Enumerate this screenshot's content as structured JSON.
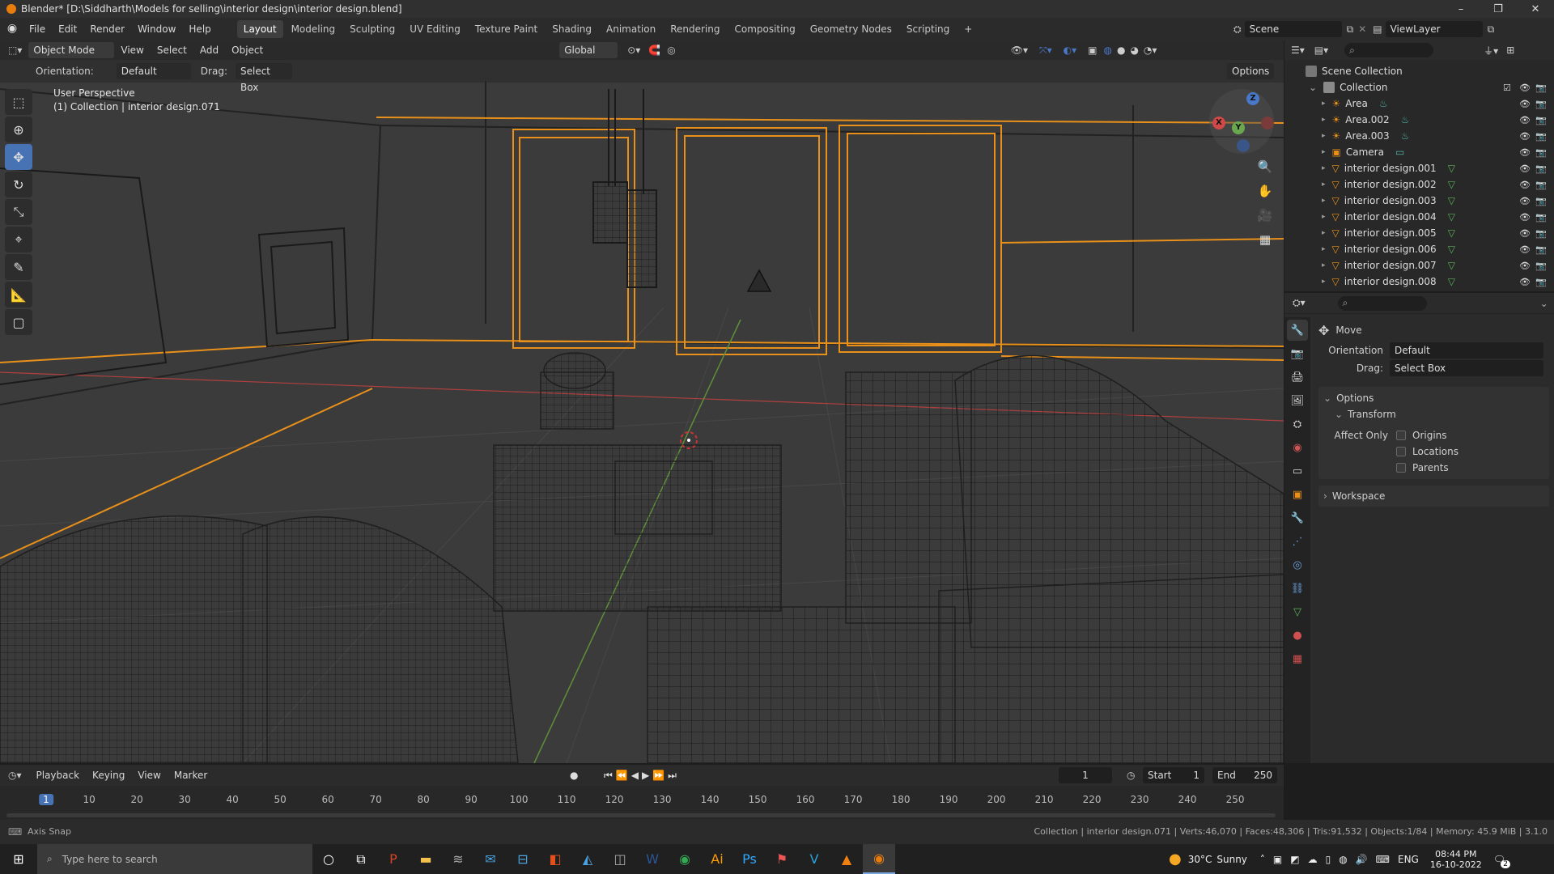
{
  "window": {
    "title": "Blender* [D:\\Siddharth\\Models for selling\\interior design\\interior design.blend]",
    "controls": [
      "–",
      "❐",
      "✕"
    ]
  },
  "menubar": {
    "menus": [
      "File",
      "Edit",
      "Render",
      "Window",
      "Help"
    ],
    "workspaces": [
      "Layout",
      "Modeling",
      "Sculpting",
      "UV Editing",
      "Texture Paint",
      "Shading",
      "Animation",
      "Rendering",
      "Compositing",
      "Geometry Nodes",
      "Scripting",
      "+"
    ],
    "active_workspace": "Layout",
    "scene": "Scene",
    "view_layer": "ViewLayer"
  },
  "viewport_header": {
    "mode": "Object Mode",
    "menus": [
      "View",
      "Select",
      "Add",
      "Object"
    ],
    "transform_orientation": "Global",
    "orientation_label": "Orientation:",
    "orientation_value": "Default",
    "drag_label": "Drag:",
    "drag_value": "Select Box",
    "options_label": "Options"
  },
  "viewport": {
    "view_name": "User Perspective",
    "active_info": "(1) Collection | interior design.071",
    "gizmo_axes": [
      "X",
      "Y",
      "Z"
    ]
  },
  "outliner": {
    "root": "Scene Collection",
    "collection": "Collection",
    "items": [
      {
        "name": "Area",
        "type": "light"
      },
      {
        "name": "Area.002",
        "type": "light"
      },
      {
        "name": "Area.003",
        "type": "light"
      },
      {
        "name": "Camera",
        "type": "camera"
      },
      {
        "name": "interior design.001",
        "type": "mesh"
      },
      {
        "name": "interior design.002",
        "type": "mesh"
      },
      {
        "name": "interior design.003",
        "type": "mesh"
      },
      {
        "name": "interior design.004",
        "type": "mesh"
      },
      {
        "name": "interior design.005",
        "type": "mesh"
      },
      {
        "name": "interior design.006",
        "type": "mesh"
      },
      {
        "name": "interior design.007",
        "type": "mesh"
      },
      {
        "name": "interior design.008",
        "type": "mesh"
      }
    ]
  },
  "properties": {
    "tool_name": "Move",
    "orientation_label": "Orientation",
    "orientation_value": "Default",
    "drag_label": "Drag:",
    "drag_value": "Select Box",
    "options_panel": "Options",
    "transform_panel": "Transform",
    "affect_only_label": "Affect Only",
    "affect_only": [
      "Origins",
      "Locations",
      "Parents"
    ],
    "workspace_panel": "Workspace"
  },
  "timeline": {
    "menus": [
      "Playback",
      "Keying",
      "View",
      "Marker"
    ],
    "current_frame": "1",
    "start_label": "Start",
    "start": "1",
    "end_label": "End",
    "end": "250",
    "ticks": [
      "1",
      "10",
      "20",
      "30",
      "40",
      "50",
      "60",
      "70",
      "80",
      "90",
      "100",
      "110",
      "120",
      "130",
      "140",
      "150",
      "160",
      "170",
      "180",
      "190",
      "200",
      "210",
      "220",
      "230",
      "240",
      "250"
    ]
  },
  "statusbar": {
    "left": "Axis Snap",
    "right": "Collection | interior design.071 | Verts:46,070 | Faces:48,306 | Tris:91,532 | Objects:1/84 | Memory: 45.9 MiB | 3.1.0"
  },
  "taskbar": {
    "search_placeholder": "Type here to search",
    "weather_temp": "30°C",
    "weather_text": "Sunny",
    "language": "ENG",
    "time": "08:44 PM",
    "date": "16-10-2022",
    "notif_count": "2"
  },
  "colors": {
    "accent": "#4772b3",
    "selection_outline": "#e8901a",
    "axis_x": "#d04848",
    "axis_y": "#6aa84f",
    "axis_z": "#4a78c8"
  }
}
